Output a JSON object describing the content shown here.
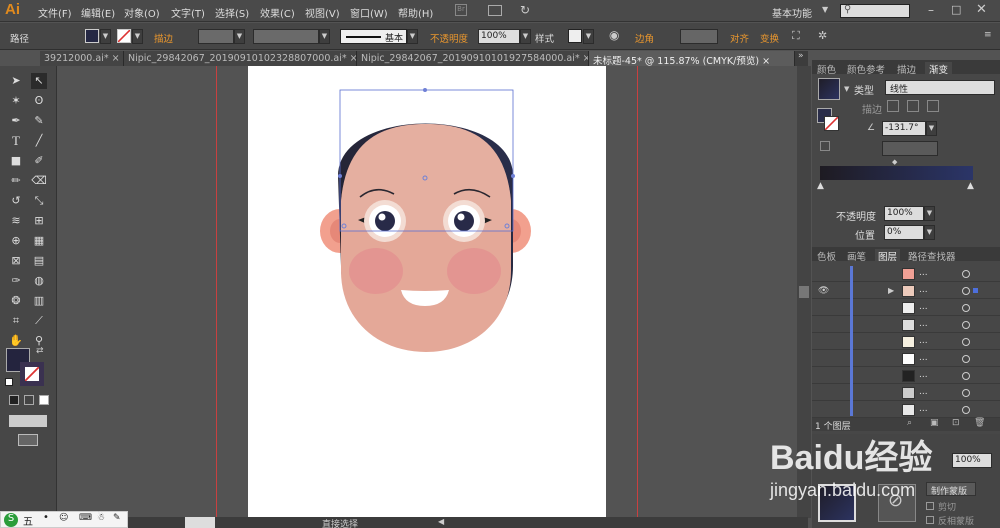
{
  "app": {
    "logo": "Ai"
  },
  "menu": [
    "文件(F)",
    "编辑(E)",
    "对象(O)",
    "文字(T)",
    "选择(S)",
    "效果(C)",
    "视图(V)",
    "窗口(W)",
    "帮助(H)"
  ],
  "menu_right": {
    "workspace": "基本功能"
  },
  "control": {
    "path_label": "路径",
    "stroke_label": "描边",
    "stroke_style": "基本",
    "opacity_label": "不透明度",
    "opacity_value": "100%",
    "style_label": "样式",
    "corner_label": "边角",
    "align_label": "对齐",
    "transform_label": "变换"
  },
  "tabs": [
    "39212000.ai*",
    "Nipic_29842067_20190910102328807000.ai*",
    "Nipic_29842067_20190910101927584000.ai*",
    "未标题-45* @ 115.87% (CMYK/预览)"
  ],
  "panel_tabs_top": [
    "颜色",
    "颜色参考",
    "描边",
    "渐变"
  ],
  "gradient": {
    "type_label": "类型",
    "type_value": "线性",
    "stroke_label": "描边",
    "angle_value": "-131.7°",
    "opacity_label": "不透明度",
    "opacity_value": "100%",
    "position_label": "位置",
    "position_value": "0%"
  },
  "panel_tabs_mid": [
    "色板",
    "画笔",
    "图层",
    "路径查找器"
  ],
  "layers": {
    "rows": [
      {
        "name": "..."
      },
      {
        "name": "..."
      },
      {
        "name": "..."
      },
      {
        "name": "..."
      },
      {
        "name": "..."
      },
      {
        "name": "..."
      },
      {
        "name": "..."
      },
      {
        "name": "..."
      },
      {
        "name": "..."
      }
    ],
    "count": "1 个图层"
  },
  "bottom_panel": {
    "make_mask": "制作蒙版",
    "clip": "剪切",
    "invert": "反相蒙版",
    "opacity_value": "100%"
  },
  "watermark": {
    "brand": "Baidu经验",
    "url": "jingyan.baidu.com"
  },
  "status": {
    "tool": "直接选择"
  },
  "colors": {
    "hair": "#2a2730",
    "face": "#e6a898",
    "cheek": "#e39090",
    "ear": "#f0a595"
  }
}
